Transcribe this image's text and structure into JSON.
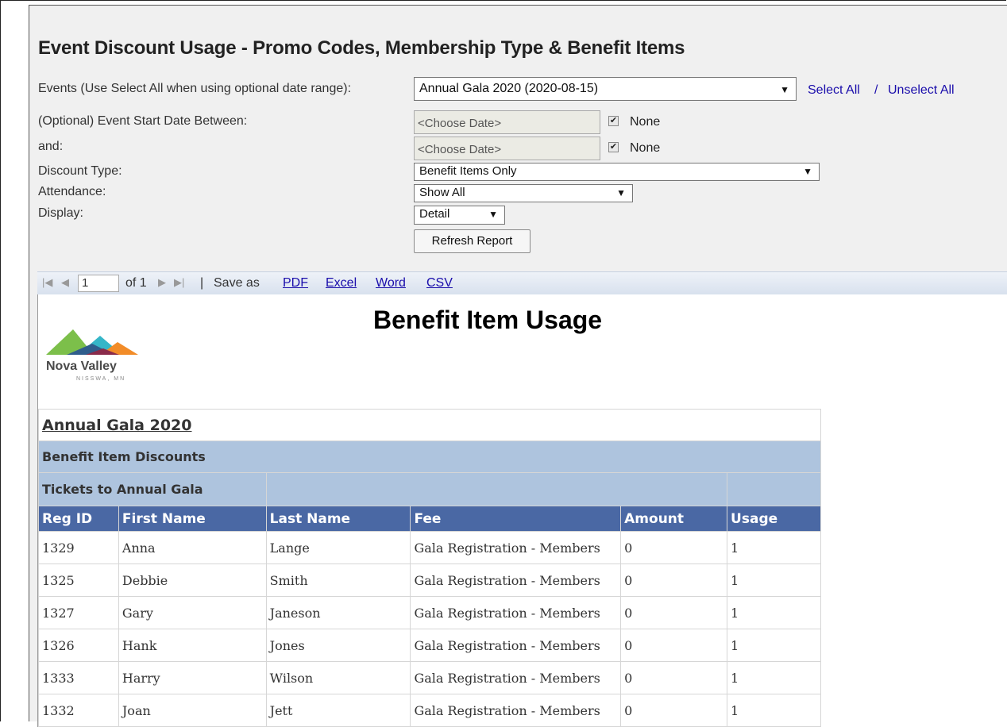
{
  "page_title": "Event Discount Usage - Promo Codes, Membership Type & Benefit Items",
  "filters": {
    "events_label": "Events (Use Select All when using optional date range):",
    "events_value": "Annual Gala 2020 (2020-08-15)",
    "select_all": "Select All",
    "slash": "/",
    "unselect_all": "Unselect All",
    "start_label": "(Optional) Event Start Date Between:",
    "and_label": "and:",
    "date_placeholder_1": "<Choose Date>",
    "date_placeholder_2": "<Choose Date>",
    "none_1": "None",
    "none_2": "None",
    "discount_label": "Discount Type:",
    "discount_value": "Benefit Items Only",
    "attendance_label": "Attendance:",
    "attendance_value": "Show All",
    "display_label": "Display:",
    "display_value": "Detail",
    "refresh_button": "Refresh Report"
  },
  "toolbar": {
    "page_value": "1",
    "of_pages": "of 1",
    "separator": "|",
    "save_as": "Save as",
    "formats": [
      "PDF",
      "Excel",
      "Word",
      "CSV"
    ]
  },
  "report": {
    "title": "Benefit Item Usage",
    "logo_name": "Nova Valley",
    "logo_city": "NISSWA, MN",
    "event_name": "Annual Gala 2020",
    "section": "Benefit Item Discounts",
    "subsection": "Tickets to Annual Gala",
    "columns": [
      "Reg ID",
      "First Name",
      "Last Name",
      "Fee",
      "Amount",
      "Usage"
    ],
    "rows": [
      [
        "1329",
        "Anna",
        "Lange",
        "Gala Registration - Members",
        "0",
        "1"
      ],
      [
        "1325",
        "Debbie",
        "Smith",
        "Gala Registration - Members",
        "0",
        "1"
      ],
      [
        "1327",
        "Gary",
        "Janeson",
        "Gala Registration - Members",
        "0",
        "1"
      ],
      [
        "1326",
        "Hank",
        "Jones",
        "Gala Registration - Members",
        "0",
        "1"
      ],
      [
        "1333",
        "Harry",
        "Wilson",
        "Gala Registration - Members",
        "0",
        "1"
      ],
      [
        "1332",
        "Joan",
        "Jett",
        "Gala Registration - Members",
        "0",
        "1"
      ]
    ]
  },
  "icons": {
    "first": "first-page-icon",
    "prev": "prev-page-icon",
    "next": "next-page-icon",
    "last": "last-page-icon"
  }
}
